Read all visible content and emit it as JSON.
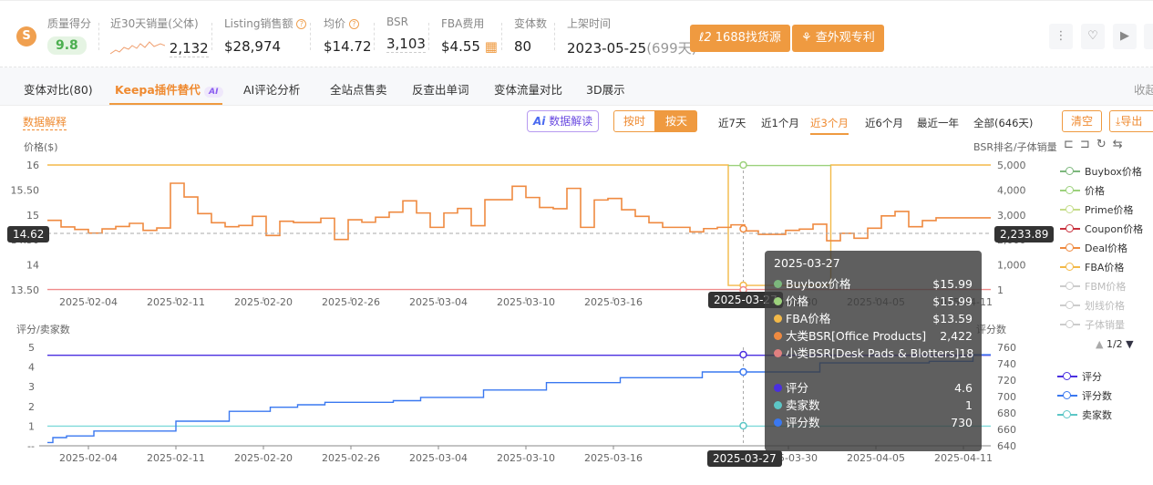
{
  "header": {
    "logo": "S",
    "quality_label": "质量得分",
    "quality_value": "9.8",
    "sales_label": "近30天销量(父体)",
    "sales_value": "2,132",
    "revenue_label": "Listing销售额",
    "revenue_value": "$28,974",
    "avg_price_label": "均价",
    "avg_price_value": "$14.72",
    "bsr_label": "BSR",
    "bsr_value": "3,103",
    "fba_label": "FBA费用",
    "fba_value": "$4.55",
    "variants_label": "变体数",
    "variants_value": "80",
    "launch_label": "上架时间",
    "launch_value": "2023-05-25",
    "launch_days": "(699天)",
    "btn_1688": "1688找货源",
    "btn_patent": "查外观专利"
  },
  "tabs": [
    {
      "label": "变体对比(80)"
    },
    {
      "label": "Keepa插件替代"
    },
    {
      "label": "AI评论分析"
    },
    {
      "label": "全站点售卖"
    },
    {
      "label": "反查出单词"
    },
    {
      "label": "变体流量对比"
    },
    {
      "label": "3D展示"
    }
  ],
  "tab_ai_badge": "AI",
  "collapse": "收起",
  "toolbar": {
    "explain": "数据解释",
    "ai_read": "数据解读",
    "by_hour": "按时",
    "by_day": "按天",
    "ranges": [
      "近7天",
      "近1个月",
      "近3个月",
      "近6个月",
      "最近一年",
      "全部(646天)"
    ],
    "clear": "清空",
    "export": "导出"
  },
  "legend": {
    "items": [
      {
        "label": "Buybox价格",
        "color": "#7cb77c",
        "on": true
      },
      {
        "label": "价格",
        "color": "#9cd17c",
        "on": true
      },
      {
        "label": "Prime价格",
        "color": "#c5dd8a",
        "on": true
      },
      {
        "label": "Coupon价格",
        "color": "#c8303c",
        "on": true
      },
      {
        "label": "Deal价格",
        "color": "#ef8a40",
        "on": true
      },
      {
        "label": "FBA价格",
        "color": "#f3b948",
        "on": true
      },
      {
        "label": "FBM价格",
        "color": "#ccc",
        "on": false
      },
      {
        "label": "划线价格",
        "color": "#ccc",
        "on": false
      },
      {
        "label": "子体销量",
        "color": "#ccc",
        "on": false
      }
    ],
    "page": "1/2",
    "bottom_items": [
      {
        "label": "评分",
        "color": "#4a2fe0"
      },
      {
        "label": "评分数",
        "color": "#3a78f0"
      },
      {
        "label": "卖家数",
        "color": "#5cc6c6"
      }
    ]
  },
  "tooltip": {
    "date": "2025-03-27",
    "rows": [
      {
        "label": "Buybox价格",
        "value": "$15.99",
        "color": "#7cb77c"
      },
      {
        "label": "价格",
        "value": "$15.99",
        "color": "#9cd17c"
      },
      {
        "label": "FBA价格",
        "value": "$13.59",
        "color": "#f3b948"
      },
      {
        "label": "大类BSR[Office Products]",
        "value": "2,422",
        "color": "#ef8a40"
      },
      {
        "label": "小类BSR[Desk Pads & Blotters]",
        "value": "18",
        "color": "#e08080"
      }
    ],
    "rows2": [
      {
        "label": "评分",
        "value": "4.6",
        "color": "#4a2fe0"
      },
      {
        "label": "卖家数",
        "value": "1",
        "color": "#5cc6c6"
      },
      {
        "label": "评分数",
        "value": "730",
        "color": "#3a78f0"
      }
    ]
  },
  "cursor": {
    "date": "2025-03-27",
    "price": "14.62",
    "bsr": "2,233.89"
  },
  "chart_data": [
    {
      "type": "line",
      "title": "price/BSR",
      "ylabel": "价格($)",
      "y2label": "BSR排名/子体销量",
      "ylim": [
        13.5,
        16
      ],
      "yticks": [
        "16",
        "15.50",
        "15",
        "14.50",
        "14",
        "13.50"
      ],
      "yvals": [
        16,
        15.5,
        15,
        14.5,
        14,
        13.5
      ],
      "y2lim": [
        1,
        5000
      ],
      "y2ticks": [
        "5,000",
        "4,000",
        "3,000",
        "2,000",
        "1,000",
        "1"
      ],
      "y2vals": [
        5000,
        4000,
        3000,
        2000,
        1000,
        1
      ],
      "xlim": [
        0,
        69
      ],
      "xticks": [
        {
          "label": "2025-02-04",
          "x": 3
        },
        {
          "label": "2025-02-11",
          "x": 9.4
        },
        {
          "label": "2025-02-20",
          "x": 15.8
        },
        {
          "label": "2025-02-26",
          "x": 22.2
        },
        {
          "label": "2025-03-04",
          "x": 28.6
        },
        {
          "label": "2025-03-10",
          "x": 35
        },
        {
          "label": "2025-03-16",
          "x": 41.4
        },
        {
          "label": "2025-03-30",
          "x": 54.2
        },
        {
          "label": "2025-04-05",
          "x": 60.6
        },
        {
          "label": "2025-04-11",
          "x": 67
        }
      ],
      "series": [
        {
          "name": "FBA价格",
          "axis": "left",
          "color": "#f3b948",
          "steps": [
            [
              0,
              16
            ],
            [
              49.8,
              13.59
            ],
            [
              57.3,
              16
            ],
            [
              69,
              16
            ]
          ]
        },
        {
          "name": "Buybox价格",
          "axis": "left",
          "color": "#9cd17c",
          "steps": [
            [
              49.8,
              15.99
            ],
            [
              57.3,
              15.99
            ]
          ]
        },
        {
          "name": "小类BSR",
          "axis": "right",
          "color": "#f08a8a",
          "steps": [
            [
              0,
              18
            ],
            [
              69,
              18
            ]
          ]
        },
        {
          "name": "大类BSR",
          "axis": "right",
          "color": "#ef8a40",
          "daily": [
            2785,
            2520,
            2420,
            2275,
            2445,
            2540,
            2665,
            2385,
            2480,
            4270,
            3720,
            3055,
            2690,
            2530,
            2580,
            2945,
            2180,
            2750,
            2700,
            2700,
            2870,
            2020,
            2810,
            2710,
            2910,
            3115,
            3565,
            3080,
            2505,
            3080,
            3260,
            2570,
            3610,
            3610,
            4150,
            3700,
            3300,
            3250,
            4065,
            2505,
            3600,
            3660,
            3210,
            2945,
            2690,
            2505,
            2505,
            2325,
            2455,
            2505,
            2605,
            2360,
            2225,
            2225,
            2385,
            2435,
            2630,
            1970,
            2265,
            2070,
            2470,
            2965,
            3140,
            2530,
            2775,
            2885,
            2885,
            2885,
            2885
          ]
        }
      ],
      "cursor_x": 50.9
    },
    {
      "type": "line",
      "title": "rating",
      "ylabel": "评分/卖家数",
      "y2label": "评分数",
      "ylim": [
        0,
        5
      ],
      "yticks": [
        "5",
        "4",
        "3",
        "2",
        "1",
        "--"
      ],
      "yvals": [
        5,
        4,
        3,
        2,
        1,
        0
      ],
      "y2lim": [
        640,
        760
      ],
      "y2ticks": [
        "760",
        "740",
        "720",
        "700",
        "680",
        "660",
        "640"
      ],
      "y2vals": [
        760,
        740,
        720,
        700,
        680,
        660,
        640
      ],
      "xlim": [
        0,
        69
      ],
      "series": [
        {
          "name": "评分",
          "axis": "left",
          "color": "#4a2fe0",
          "steps": [
            [
              0,
              4.6
            ],
            [
              69,
              4.6
            ]
          ]
        },
        {
          "name": "卖家数",
          "axis": "left",
          "color": "#7fdada",
          "steps": [
            [
              0,
              1
            ],
            [
              69,
              1
            ]
          ]
        },
        {
          "name": "评分数",
          "axis": "right",
          "color": "#3a78f0",
          "steps": [
            [
              0,
              644
            ],
            [
              0.4,
              650
            ],
            [
              1.4,
              652
            ],
            [
              3.4,
              658
            ],
            [
              9.4,
              670
            ],
            [
              13.3,
              682
            ],
            [
              16.3,
              687
            ],
            [
              18.3,
              690
            ],
            [
              20.3,
              693
            ],
            [
              25.3,
              695
            ],
            [
              27.3,
              699
            ],
            [
              31.9,
              708
            ],
            [
              36.5,
              717
            ],
            [
              41.9,
              723
            ],
            [
              47.9,
              730
            ],
            [
              56.5,
              741
            ],
            [
              64.5,
              743
            ],
            [
              67.7,
              751
            ],
            [
              69,
              751
            ]
          ]
        }
      ],
      "cursor_x": 50.9
    }
  ]
}
